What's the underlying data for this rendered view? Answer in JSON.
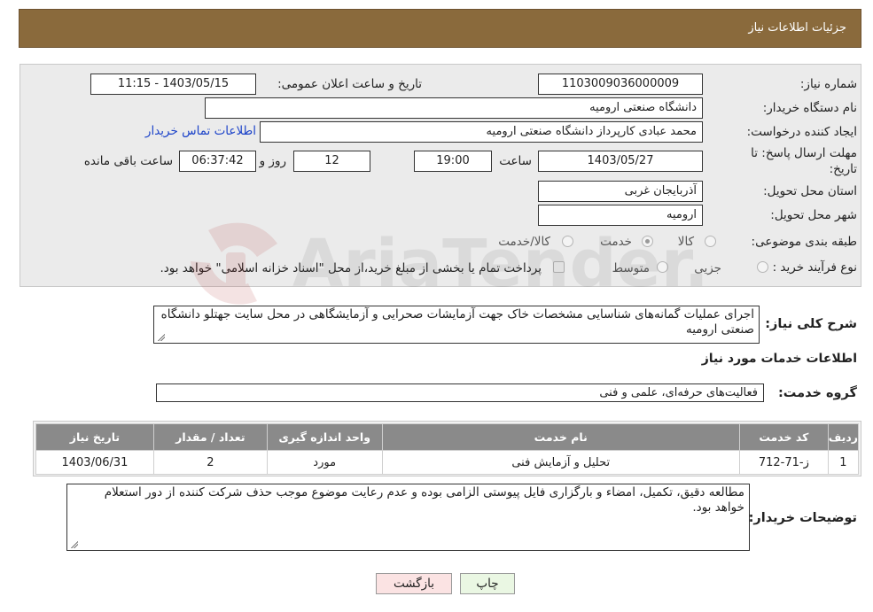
{
  "header": {
    "title": "جزئیات اطلاعات نیاز"
  },
  "form": {
    "need_number_label": "شماره نیاز:",
    "need_number": "1103009036000009",
    "announce_label": "تاریخ و ساعت اعلان عمومی:",
    "announce_value": "1403/05/15 - 11:15",
    "buyer_label": "نام دستگاه خریدار:",
    "buyer_value": "دانشگاه صنعتی ارومیه",
    "creator_label": "ایجاد کننده درخواست:",
    "creator_value": "محمد عبادی کارپرداز دانشگاه صنعتی ارومیه",
    "contact_link": "اطلاعات تماس خریدار",
    "deadline_label_1": "مهلت ارسال پاسخ: تا",
    "deadline_label_2": "تاریخ:",
    "deadline_date": "1403/05/27",
    "time_label": "ساعت",
    "deadline_time": "19:00",
    "days_value": "12",
    "days_label": "روز و",
    "remaining_time": "06:37:42",
    "remaining_label": "ساعت باقی مانده",
    "province_label": "استان محل تحویل:",
    "province_value": "آذربایجان غربی",
    "city_label": "شهر محل تحویل:",
    "city_value": "ارومیه",
    "category_label": "طبقه بندی موضوعی:",
    "category_options": [
      "کالا",
      "خدمت",
      "کالا/خدمت"
    ],
    "category_selected": "خدمت",
    "process_label": "نوع فرآیند خرید :",
    "process_options": [
      "جزیی",
      "متوسط"
    ],
    "payment_note": "پرداخت تمام یا بخشی از مبلغ خرید،از محل \"اسناد خزانه اسلامی\" خواهد بود."
  },
  "description": {
    "label": "شرح کلی نیاز:",
    "text": "اجرای عملیات گمانه‌های شناسایی مشخصات خاک جهت آزمایشات صحرایی و آزمایشگاهی در محل سایت جهتلو دانشگاه صنعتی ارومیه"
  },
  "services": {
    "section_title": "اطلاعات خدمات مورد نیاز",
    "group_label": "گروه خدمت:",
    "group_value": "فعالیت‌های حرفه‌ای، علمی و فنی",
    "columns": [
      "ردیف",
      "کد خدمت",
      "نام خدمت",
      "واحد اندازه گیری",
      "تعداد / مقدار",
      "تاریخ نیاز"
    ],
    "rows": [
      [
        "1",
        "ز-71-712",
        "تحلیل و آزمایش فنی",
        "مورد",
        "2",
        "1403/06/31"
      ]
    ]
  },
  "buyer_notes": {
    "label": "توضیحات خریدار:",
    "text": "مطالعه دقیق، تکمیل، امضاء و بارگزاری فایل پیوستی الزامی بوده و عدم رعایت موضوع موجب حذف شرکت کننده از دور استعلام خواهد بود."
  },
  "buttons": {
    "print": "چاپ",
    "back": "بازگشت"
  },
  "watermark": {
    "text": "AriaTender.neT"
  }
}
